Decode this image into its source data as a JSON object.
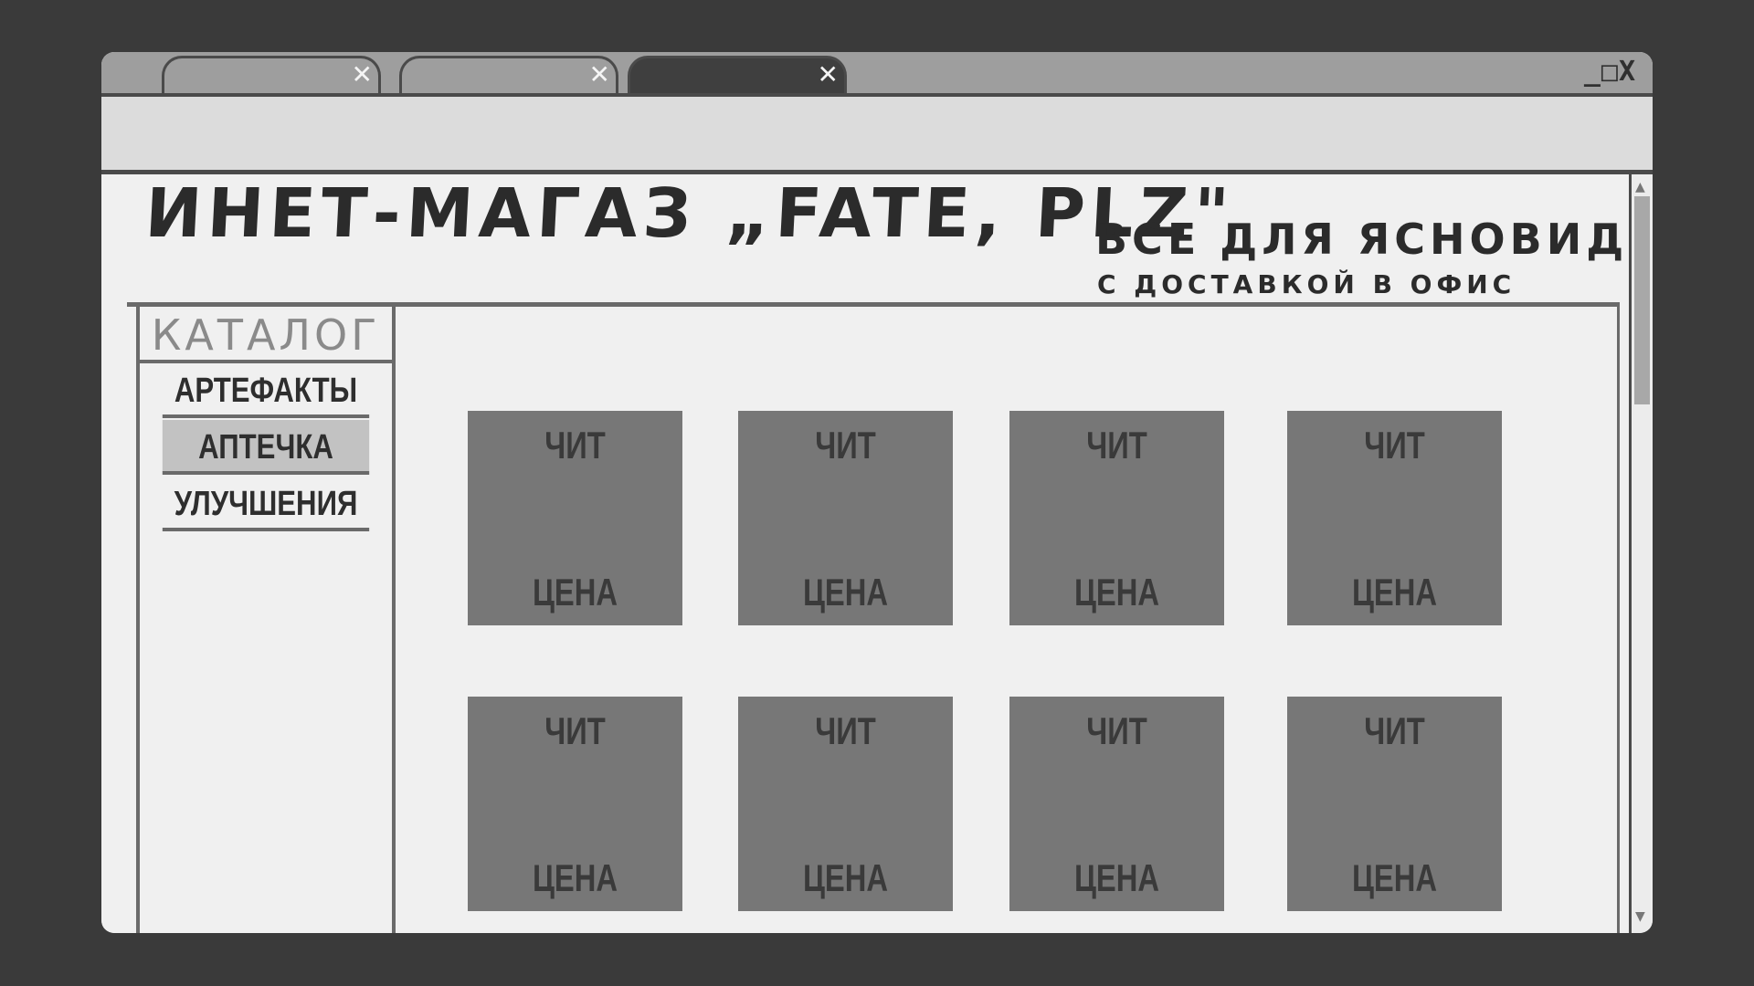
{
  "window": {
    "tabs": [
      {
        "close": "✕"
      },
      {
        "close": "✕"
      },
      {
        "close": "✕",
        "active": true
      }
    ],
    "controls": {
      "minimize": "_",
      "maximize": "□",
      "close": "X"
    }
  },
  "header": {
    "title": "ИНЕТ-МАГАЗ „FATE, PLZ\"",
    "tagline": "ВСЕ ДЛЯ ЯСНОВИДЦА",
    "subtagline": "С ДОСТАВКОЙ В ОФИС"
  },
  "sidebar": {
    "title": "КАТАЛОГ",
    "items": [
      {
        "label": "АРТЕФАКТЫ",
        "selected": false
      },
      {
        "label": "АПТЕЧКА",
        "selected": true
      },
      {
        "label": "УЛУЧШЕНИЯ",
        "selected": false
      }
    ]
  },
  "products": [
    {
      "name": "ЧИТ",
      "price": "ЦЕНА"
    },
    {
      "name": "ЧИТ",
      "price": "ЦЕНА"
    },
    {
      "name": "ЧИТ",
      "price": "ЦЕНА"
    },
    {
      "name": "ЧИТ",
      "price": "ЦЕНА"
    },
    {
      "name": "ЧИТ",
      "price": "ЦЕНА"
    },
    {
      "name": "ЧИТ",
      "price": "ЦЕНА"
    },
    {
      "name": "ЧИТ",
      "price": "ЦЕНА"
    },
    {
      "name": "ЧИТ",
      "price": "ЦЕНА"
    }
  ],
  "colors": {
    "background": "#3a3a3a",
    "page": "#f0f0f0",
    "card": "#777777",
    "selected_item": "#c2c2c2"
  }
}
